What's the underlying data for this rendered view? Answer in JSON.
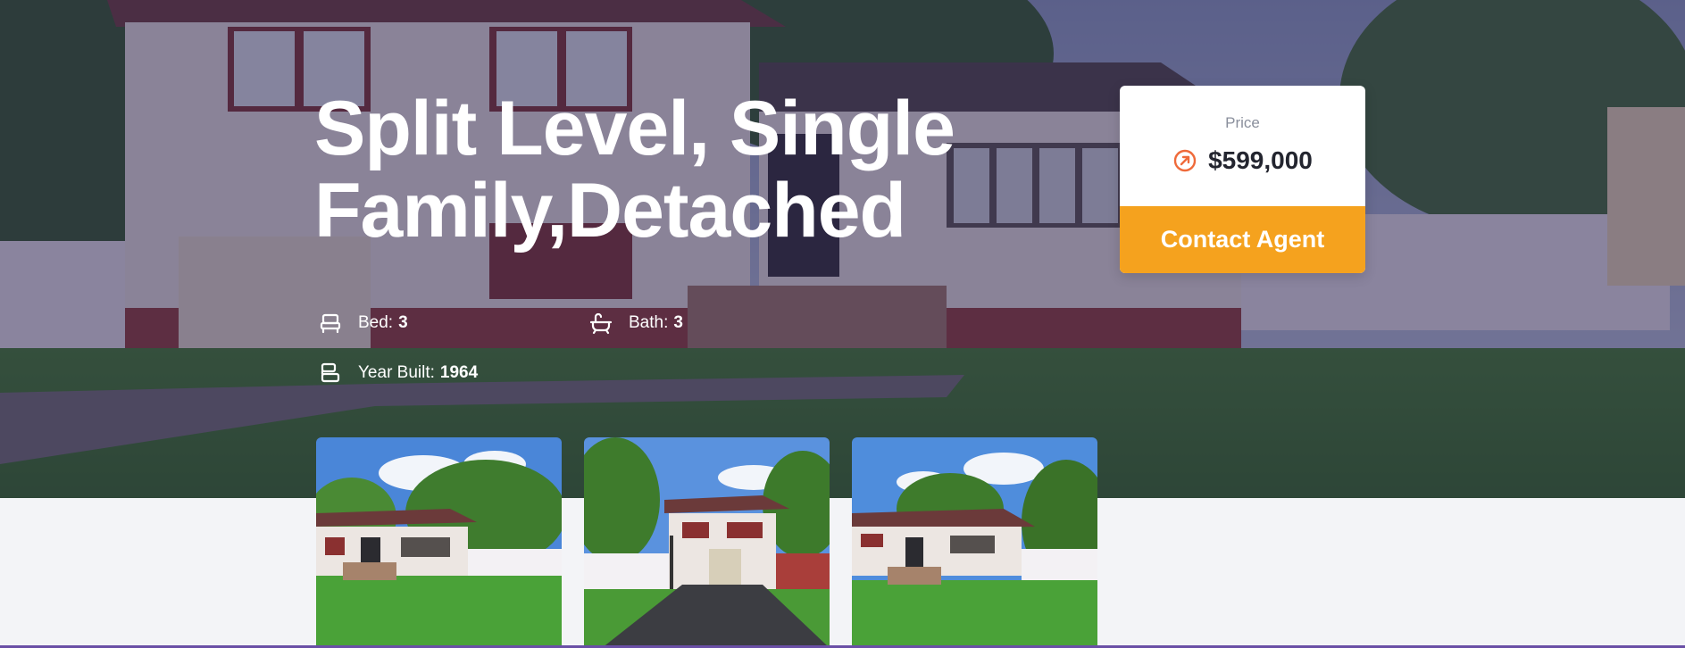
{
  "listing": {
    "title": "Split Level, Single Family,Detached"
  },
  "features": {
    "bed_label": "Bed:",
    "bed_value": "3",
    "bath_label": "Bath:",
    "bath_value": "3",
    "year_label": "Year Built:",
    "year_value": "1964"
  },
  "price_card": {
    "label": "Price",
    "value": "$599,000",
    "button_label": "Contact Agent",
    "icon": "arrow-up-right-circle-icon"
  },
  "gallery": {
    "thumbnails": [
      "house-front-photo",
      "driveway-garage-photo",
      "house-side-lawn-photo"
    ]
  },
  "colors": {
    "accent": "#f5a21e",
    "price_icon": "#ef6a3a",
    "hero_overlay": "#2c224e",
    "page_bg": "#f3f4f7",
    "bottom_border": "#6a4fa6"
  },
  "icons": {
    "bed": "bed-icon",
    "bath": "bath-icon",
    "year": "building-icon"
  }
}
